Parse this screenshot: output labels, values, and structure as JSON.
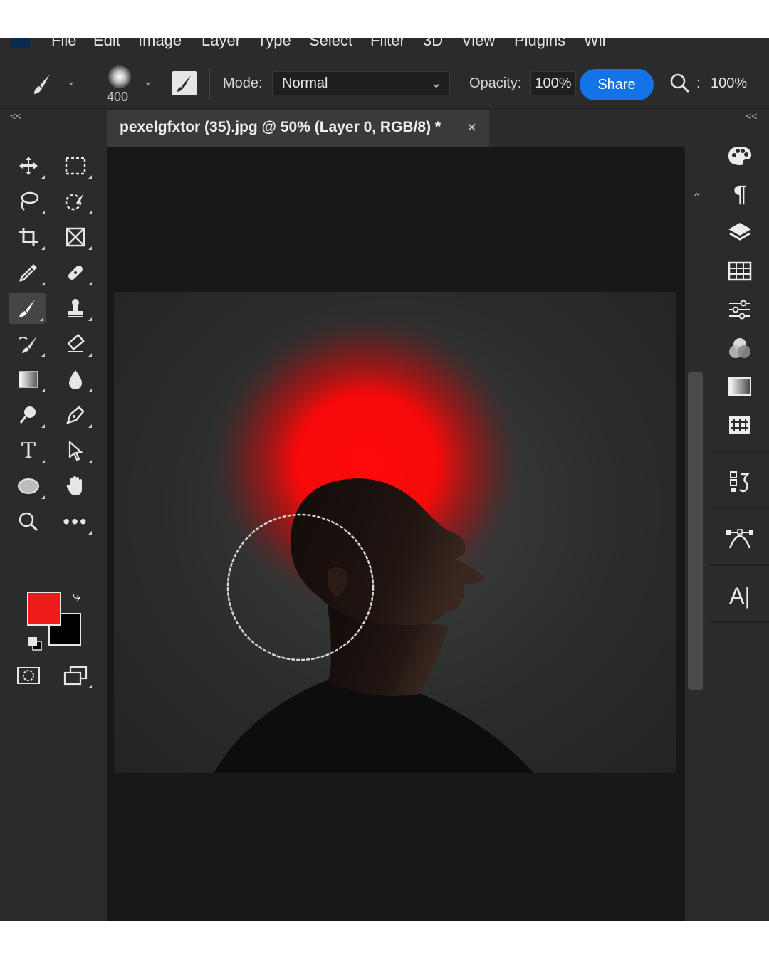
{
  "menu": {
    "items": [
      "File",
      "Edit",
      "Image",
      "Layer",
      "Type",
      "Select",
      "Filter",
      "3D",
      "View",
      "Plugins",
      "Wir"
    ]
  },
  "options_bar": {
    "brush_size": "400",
    "mode_label": "Mode:",
    "mode_value": "Normal",
    "opacity_label": "Opacity:",
    "opacity_value": "100%",
    "share_label": "Share",
    "zoom_value": "100%"
  },
  "toolbar": {
    "collapse": "<<",
    "foreground_color": "#ee1b1b",
    "background_color": "#000000",
    "tools": [
      "move-tool",
      "marquee-tool",
      "lasso-tool",
      "quick-selection-tool",
      "crop-tool",
      "frame-tool",
      "eyedropper-tool",
      "spot-healing-tool",
      "brush-tool",
      "clone-stamp-tool",
      "history-brush-tool",
      "eraser-tool",
      "gradient-tool",
      "blur-tool",
      "dodge-tool",
      "pen-tool",
      "type-tool",
      "path-selection-tool",
      "ellipse-tool",
      "hand-tool",
      "zoom-tool",
      "more-tools"
    ],
    "active_tool": "brush-tool"
  },
  "document": {
    "tab_title": "pexelgfxtor (35).jpg @ 50% (Layer 0, RGB/8) *",
    "close_glyph": "×"
  },
  "right_panel": {
    "collapse": "<<",
    "icons": [
      "color-palette-icon",
      "paragraph-icon",
      "layers-icon",
      "swatches-grid-icon",
      "adjustments-icon",
      "channels-icon",
      "gradients-icon",
      "patterns-icon",
      "history-icon",
      "paths-icon",
      "character-icon"
    ]
  }
}
